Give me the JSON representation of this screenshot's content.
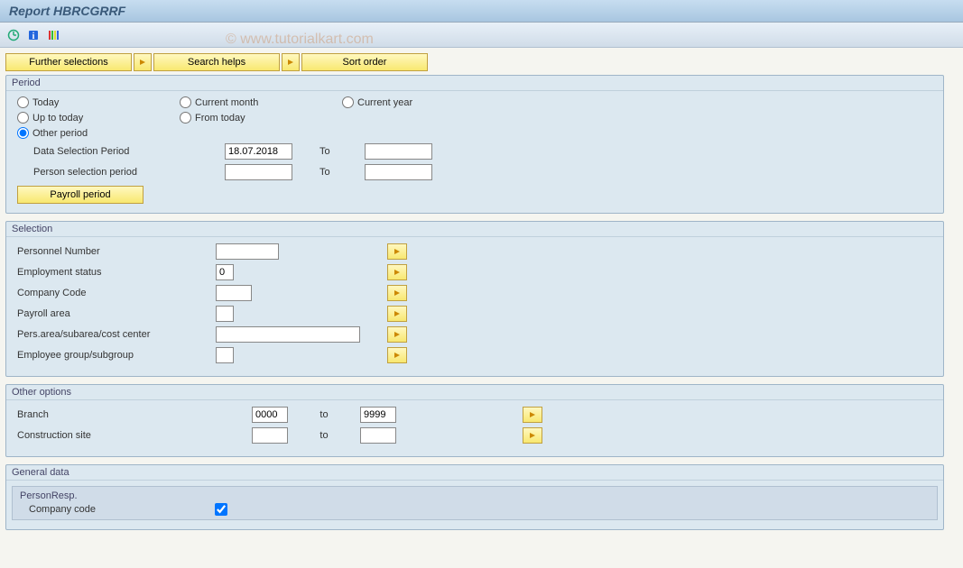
{
  "title": "Report HBRCGRRF",
  "watermark": "© www.tutorialkart.com",
  "topButtons": {
    "further": "Further selections",
    "search": "Search helps",
    "sort": "Sort order"
  },
  "period": {
    "title": "Period",
    "radios": {
      "today": "Today",
      "currentMonth": "Current month",
      "currentYear": "Current year",
      "upToToday": "Up to today",
      "fromToday": "From today",
      "other": "Other period"
    },
    "dataSelLabel": "Data Selection Period",
    "dataSelValue": "18.07.2018",
    "personSelLabel": "Person selection period",
    "to": "To",
    "payrollBtn": "Payroll period"
  },
  "selection": {
    "title": "Selection",
    "rows": [
      {
        "label": "Personnel Number",
        "width": "med"
      },
      {
        "label": "Employment status",
        "value": "0",
        "width": "small"
      },
      {
        "label": "Company Code",
        "width": "num"
      },
      {
        "label": "Payroll area",
        "width": "small"
      },
      {
        "label": "Pers.area/subarea/cost center",
        "width": "wide"
      },
      {
        "label": "Employee group/subgroup",
        "width": "small"
      }
    ]
  },
  "other": {
    "title": "Other options",
    "branchLabel": "Branch",
    "branchFrom": "0000",
    "branchTo": "9999",
    "constrLabel": "Construction site",
    "to": "to"
  },
  "general": {
    "title": "General data",
    "personResp": "PersonResp.",
    "companyCode": "Company code"
  }
}
